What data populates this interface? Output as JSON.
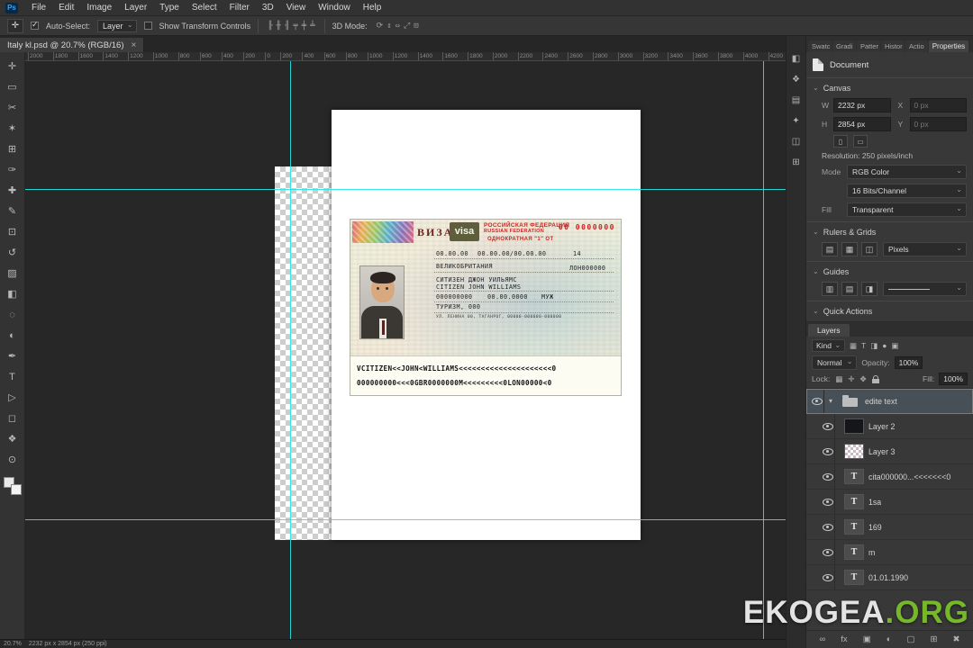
{
  "app": {
    "logo": "Ps",
    "watermark_main": "EKOGEA",
    "watermark_suffix": ".ORG"
  },
  "colors": {
    "guide_cyan": "#21e7e4",
    "watermark_green": "#76b82a",
    "visa_red": "#c22a26",
    "panel_bg": "#383838"
  },
  "menu": {
    "items": [
      "File",
      "Edit",
      "Image",
      "Layer",
      "Type",
      "Select",
      "Filter",
      "3D",
      "View",
      "Window",
      "Help"
    ]
  },
  "options_bar": {
    "tool_icon": "✛",
    "auto_select_label": "Auto-Select:",
    "auto_select_value": "Layer",
    "show_transform_label": "Show Transform Controls",
    "align_icons": [
      "╟",
      "╫",
      "╢",
      "╤",
      "╪",
      "╧"
    ],
    "mode_label": "3D Mode:",
    "mode_icons": [
      "⟳",
      "⇕",
      "⇔",
      "⤢",
      "⊡"
    ]
  },
  "document_tab": {
    "title": "Italy kl.psd @ 20.7% (RGB/16)",
    "close_icon": "×"
  },
  "ruler": {
    "ticks": [
      "2000",
      "1800",
      "1600",
      "1400",
      "1200",
      "1000",
      "800",
      "600",
      "400",
      "200",
      "0",
      "200",
      "400",
      "600",
      "800",
      "1000",
      "1200",
      "1400",
      "1600",
      "1800",
      "2000",
      "2200",
      "2400",
      "2600",
      "2800",
      "3000",
      "3200",
      "3400",
      "3600",
      "3800",
      "4000",
      "4200"
    ]
  },
  "toolbar": {
    "tools": [
      {
        "glyph": "✛",
        "name": "move-tool"
      },
      {
        "glyph": "▭",
        "name": "marquee-tool"
      },
      {
        "glyph": "✂",
        "name": "lasso-tool"
      },
      {
        "glyph": "✶",
        "name": "quick-selection-tool"
      },
      {
        "glyph": "⊞",
        "name": "crop-tool"
      },
      {
        "glyph": "✑",
        "name": "eyedropper-tool"
      },
      {
        "glyph": "✚",
        "name": "healing-brush-tool"
      },
      {
        "glyph": "✎",
        "name": "brush-tool"
      },
      {
        "glyph": "⊡",
        "name": "clone-stamp-tool"
      },
      {
        "glyph": "↺",
        "name": "history-brush-tool"
      },
      {
        "glyph": "▨",
        "name": "eraser-tool"
      },
      {
        "glyph": "◧",
        "name": "gradient-tool"
      },
      {
        "glyph": "◌",
        "name": "blur-tool"
      },
      {
        "glyph": "◐",
        "name": "dodge-tool"
      },
      {
        "glyph": "✒",
        "name": "pen-tool"
      },
      {
        "glyph": "T",
        "name": "type-tool"
      },
      {
        "glyph": "▷",
        "name": "path-selection-tool"
      },
      {
        "glyph": "◻",
        "name": "shape-tool"
      },
      {
        "glyph": "❖",
        "name": "hand-tool"
      },
      {
        "glyph": "⊙",
        "name": "zoom-tool"
      }
    ]
  },
  "dock_strip": {
    "icons": [
      {
        "glyph": "◧",
        "name": "color-panel-icon"
      },
      {
        "glyph": "❖",
        "name": "swatches-panel-icon"
      },
      {
        "glyph": "▤",
        "name": "libraries-panel-icon"
      },
      {
        "glyph": "✦",
        "name": "adjustments-panel-icon"
      },
      {
        "glyph": "◫",
        "name": "history-panel-icon"
      },
      {
        "glyph": "⊞",
        "name": "info-panel-icon"
      }
    ]
  },
  "panels": {
    "tab_labels": [
      "Swatc",
      "Gradi",
      "Patter",
      "Histor",
      "Actio"
    ],
    "properties_tab": "Properties",
    "properties": {
      "document_label": "Document",
      "canvas_header": "Canvas",
      "w_label": "W",
      "w_value": "2232 px",
      "h_label": "H",
      "h_value": "2854 px",
      "x_label": "X",
      "x_value": "0 px",
      "y_label": "Y",
      "y_value": "0 px",
      "orient_portrait_icon": "▯",
      "orient_landscape_icon": "▭",
      "resolution_text": "Resolution: 250 pixels/inch",
      "mode_label": "Mode",
      "mode_value": "RGB Color",
      "depth_value": "16 Bits/Channel",
      "fill_label": "Fill",
      "fill_value": "Transparent",
      "rulers_header": "Rulers & Grids",
      "ruler_icons": [
        "▤",
        "▦",
        "◫"
      ],
      "units_value": "Pixels",
      "guides_header": "Guides",
      "guide_icons": [
        "▥",
        "▤",
        "◨"
      ],
      "quick_actions_header": "Quick Actions"
    },
    "layers": {
      "tab_label": "Layers",
      "kind_label": "Kind",
      "filter_icons": [
        "▦",
        "T",
        "◨",
        "●",
        "▣"
      ],
      "blend_value": "Normal",
      "opacity_label": "Opacity:",
      "opacity_value": "100%",
      "lock_label": "Lock:",
      "lock_icons": [
        "▦",
        "✛",
        "✥"
      ],
      "fill_label": "Fill:",
      "fill_value": "100%",
      "items": [
        {
          "name": "edite text",
          "row_class": "group selected",
          "thumb_class": "thumb-folder",
          "glyph": ""
        },
        {
          "name": "Layer 2",
          "row_class": "child",
          "thumb_class": "thumb-image",
          "glyph": ""
        },
        {
          "name": "Layer 3",
          "row_class": "child",
          "thumb_class": "thumb-checker",
          "glyph": ""
        },
        {
          "name": "cita000000...<<<<<<<0",
          "row_class": "child",
          "thumb_class": "thumb-text",
          "glyph": "T"
        },
        {
          "name": "1sa",
          "row_class": "child",
          "thumb_class": "thumb-text",
          "glyph": "T"
        },
        {
          "name": "169",
          "row_class": "child",
          "thumb_class": "thumb-text",
          "glyph": "T"
        },
        {
          "name": "m",
          "row_class": "child",
          "thumb_class": "thumb-text",
          "glyph": "T"
        },
        {
          "name": "01.01.1990",
          "row_class": "child",
          "thumb_class": "thumb-text",
          "glyph": "T"
        }
      ],
      "bottom_icons": [
        {
          "glyph": "∞",
          "name": "link-layers-icon"
        },
        {
          "glyph": "fx",
          "name": "layer-effects-icon"
        },
        {
          "glyph": "▣",
          "name": "layer-mask-icon"
        },
        {
          "glyph": "◐",
          "name": "adjustment-layer-icon"
        },
        {
          "glyph": "▢",
          "name": "new-group-icon"
        },
        {
          "glyph": "⊞",
          "name": "new-layer-icon"
        },
        {
          "glyph": "✖",
          "name": "delete-layer-icon"
        }
      ]
    }
  },
  "visa": {
    "viza_word": "ВИЗА",
    "visa_badge": "visa",
    "country_ru": "РОССИЙСКАЯ ФЕДЕРАЦИЯ",
    "country_en": "RUSSIAN FEDERATION",
    "serial": "00 0000000",
    "entries_line": "ОДНОКРАТНАЯ \"1\" ОТ",
    "date_from": "00.00.00",
    "date_range": "00.00.00/00.00.00",
    "days": "14",
    "citizenship": "ВЕЛИКОБРИТАНИЯ",
    "invitation_no": "ЛОН000000",
    "name_ru": "СИТИЗЕН ДЖОН УИЛЬЯМС",
    "name_en": "CITIZEN JOHN WILLIAMS",
    "passport_no": "000000000",
    "birth_date": "00.00.0000",
    "sex": "МУЖ",
    "purpose": "ТУРИЗМ, 000",
    "host_line": "УЛ. ЛЕНИНА 00, ТАГАНРОГ, 00000-000000-000000",
    "mrz_line1": "VCITIZEN<<JOHN<WILLIAMS<<<<<<<<<<<<<<<<<<<<<0",
    "mrz_line2": "000000000<<<0GBR0000000M<<<<<<<<<0LON00000<0"
  },
  "status_bar": {
    "zoom": "20.7%",
    "doc_info": "2232 px x 2854 px (250 ppi)"
  }
}
